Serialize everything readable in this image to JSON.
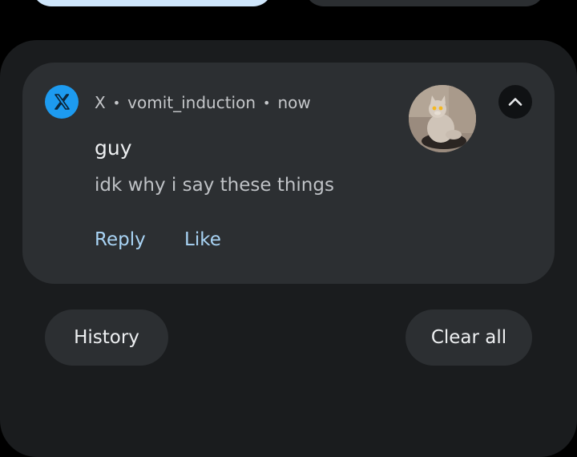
{
  "notification": {
    "app_name": "X",
    "app_icon": "x-logo-icon",
    "account": "vomit_induction",
    "time": "now",
    "separator": "•",
    "title": "guy",
    "message": "idk why i say these things",
    "avatar": "cat-photo",
    "collapse_icon": "chevron-up-icon",
    "actions": {
      "reply": "Reply",
      "like": "Like"
    }
  },
  "footer": {
    "history_label": "History",
    "clear_all_label": "Clear all"
  },
  "colors": {
    "background": "#000000",
    "panel": "#1a1c1e",
    "card": "#2c2f32",
    "x_brand_blue": "#1d9bf0",
    "action_text": "#a9d4f5"
  }
}
